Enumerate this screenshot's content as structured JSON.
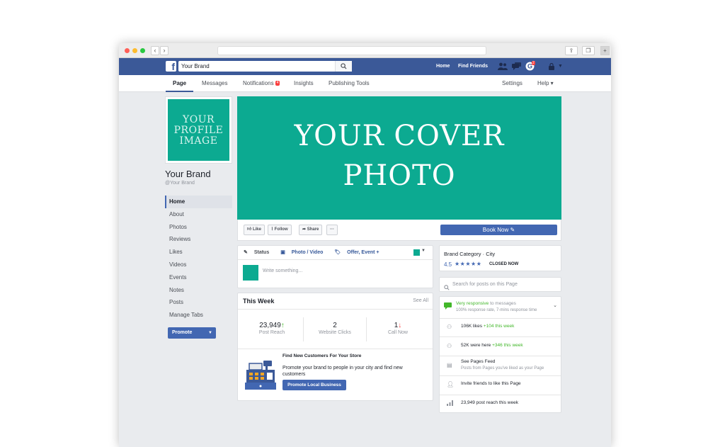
{
  "browser": {
    "back": "‹",
    "forward": "›",
    "share_icon": "share-icon",
    "tabs_icon": "tabs-icon",
    "new_tab": "+"
  },
  "topbar": {
    "logo": "f",
    "search_value": "Your Brand",
    "home": "Home",
    "find_friends": "Find Friends",
    "notif_count": "2"
  },
  "tabs": {
    "page": "Page",
    "messages": "Messages",
    "notifications": "Notifications",
    "notifications_badge": "4",
    "insights": "Insights",
    "publishing_tools": "Publishing Tools",
    "settings": "Settings",
    "help": "Help ▾"
  },
  "profile": {
    "image_text_1": "YOUR",
    "image_text_2": "PROFILE",
    "image_text_3": "IMAGE",
    "name": "Your Brand",
    "handle": "@Your Brand"
  },
  "leftnav": {
    "items": [
      "Home",
      "About",
      "Photos",
      "Reviews",
      "Likes",
      "Videos",
      "Events",
      "Notes",
      "Posts",
      "Manage Tabs"
    ],
    "promote": "Promote"
  },
  "cover": {
    "line1": "YOUR COVER",
    "line2": "PHOTO"
  },
  "actions": {
    "like": "Like",
    "follow": "Follow",
    "share": "Share",
    "more": "···",
    "book_now": "Book Now ✎"
  },
  "composer": {
    "status": "Status",
    "photo_video": "Photo / Video",
    "offer_event": "Offer, Event +",
    "placeholder": "Write something..."
  },
  "this_week": {
    "title": "This Week",
    "see_all": "See All",
    "stats": [
      {
        "value": "23,949",
        "arrow": "↑",
        "label": "Post Reach"
      },
      {
        "value": "2",
        "arrow": "",
        "label": "Website Clicks"
      },
      {
        "value": "1",
        "arrow": "↓",
        "label": "Call Now"
      }
    ],
    "promo_title": "Find New Customers For Your Store",
    "promo_text": "Promote your brand to people in your city and find new customers",
    "promo_button": "Promote Local Business"
  },
  "about_card": {
    "category": "Brand Category · City",
    "rating": "4.5",
    "stars": "★★★★★",
    "closed": "CLOSED NOW"
  },
  "search_posts": {
    "placeholder": "Search for posts on this Page"
  },
  "info_card": {
    "responsive": "Very responsive",
    "to_messages": "to messages",
    "response_rate": "100% response rate, 7-mins response time",
    "likes": "106K likes",
    "likes_delta": "+104 this week",
    "were_here": "52K were here",
    "were_here_delta": "+346 this week",
    "pages_feed": "See Pages Feed",
    "pages_feed_sub": "Posts from Pages you've liked as your Page",
    "invite": "Invite friends to like this Page",
    "reach": "23,949 post reach this week"
  },
  "colors": {
    "facebook_blue": "#3b5998",
    "button_blue": "#4267b2",
    "cover_teal": "#0caa91"
  }
}
